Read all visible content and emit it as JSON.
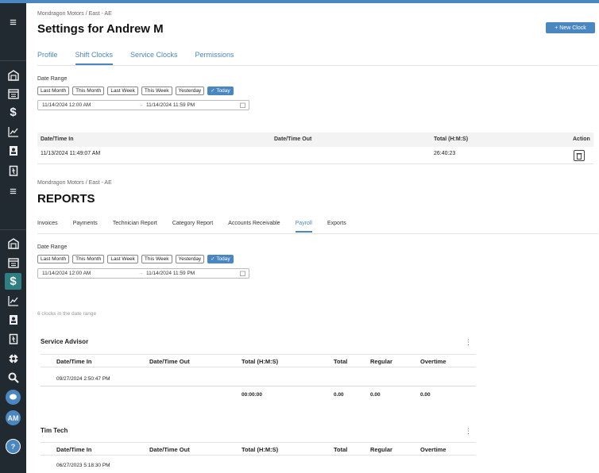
{
  "clocks_page": {
    "breadcrumb": "Mondragon Motors / East - AE",
    "title": "Settings for Andrew M",
    "new_clock_label": "+ New Clock",
    "tabs": [
      {
        "label": "Profile",
        "active": false
      },
      {
        "label": "Shift Clocks",
        "active": true
      },
      {
        "label": "Service Clocks",
        "active": false
      },
      {
        "label": "Permissions",
        "active": false
      }
    ],
    "date_range_label": "Date Range",
    "range_buttons": [
      "Last Month",
      "This Month",
      "Last Week",
      "This Week",
      "Yesterday",
      "✓ Today"
    ],
    "range_start": "11/14/2024 12:00 AM",
    "range_arrow": "→",
    "range_end": "11/14/2024 11:59 PM",
    "table_headers": [
      "Date/Time In",
      "Date/Time Out",
      "Total (H:M:S)",
      "Action"
    ],
    "rows": [
      {
        "time_in": "11/13/2024 11:49:07 AM",
        "time_out": "",
        "total": "26:40:23"
      }
    ]
  },
  "reports_page": {
    "breadcrumb": "Mondragon Motors / East - AE",
    "title": "REPORTS",
    "tabs": [
      {
        "label": "Invoices",
        "active": false
      },
      {
        "label": "Payments",
        "active": false
      },
      {
        "label": "Technician Report",
        "active": false
      },
      {
        "label": "Category Report",
        "active": false
      },
      {
        "label": "Accounts Receivable",
        "active": false
      },
      {
        "label": "Payroll",
        "active": true
      },
      {
        "label": "Exports",
        "active": false
      }
    ],
    "date_range_label": "Date Range",
    "range_buttons": [
      "Last Month",
      "This Month",
      "Last Week",
      "This Week",
      "Yesterday",
      "✓ Today"
    ],
    "range_start": "11/14/2024 12:00 AM",
    "range_arrow": "→",
    "range_end": "11/14/2024 11:59 PM",
    "clock_count_text": "6 clocks in the date range",
    "grid_headers": [
      "Date/Time In",
      "Date/Time Out",
      "Total (H:M:S)",
      "Total",
      "Regular",
      "Overtime"
    ],
    "sections": [
      {
        "name": "Service Advisor",
        "rows": [
          {
            "time_in": "09/27/2024 2:50:47 PM"
          }
        ],
        "totals": {
          "hms": "00:00:00",
          "total": "0.00",
          "regular": "0.00",
          "overtime": "0.00"
        }
      },
      {
        "name": "Tim Tech",
        "rows": [
          {
            "time_in": "06/27/2023 5:18:30 PM"
          }
        ]
      }
    ]
  },
  "sidebar": {
    "avatar_initials": "AM"
  },
  "colors": {
    "accent": "#4a87c1",
    "sidebar_bg": "#222a31",
    "sidebar_active": "#2f7f82"
  }
}
